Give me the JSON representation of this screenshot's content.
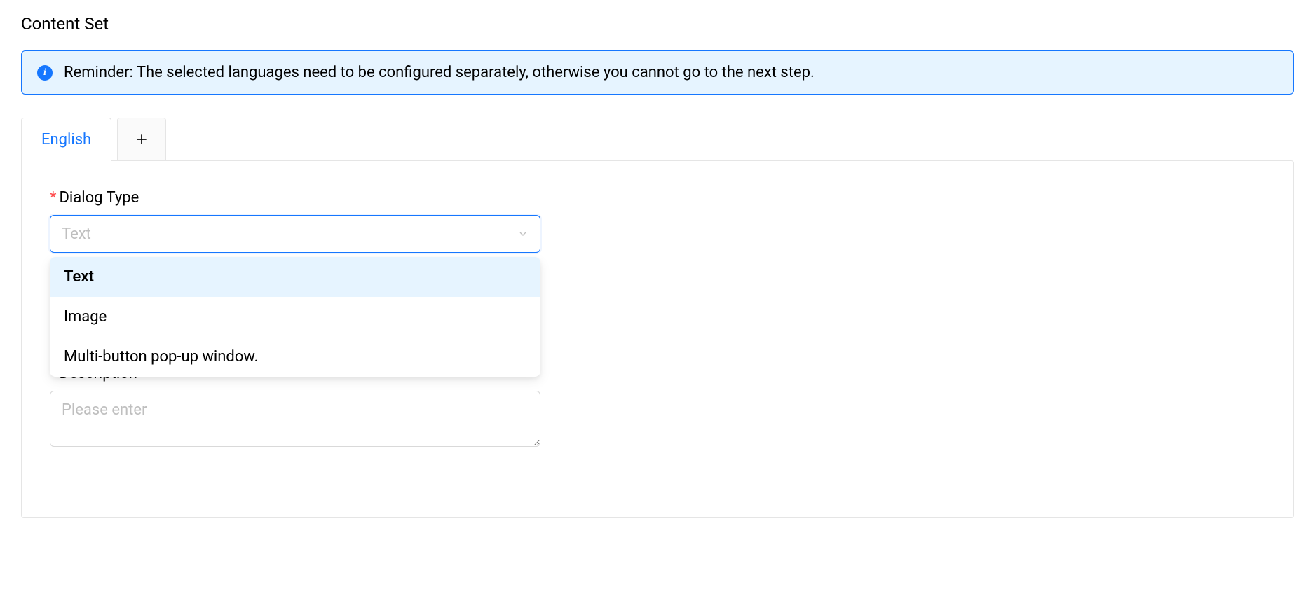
{
  "page": {
    "title": "Content Set"
  },
  "alert": {
    "text": "Reminder: The selected languages need to be configured separately, otherwise you cannot go to the next step."
  },
  "tabs": {
    "active": "English"
  },
  "form": {
    "dialog_type": {
      "label": "Dialog Type",
      "placeholder": "Text",
      "options": {
        "0": "Text",
        "1": "Image",
        "2": "Multi-button pop-up window."
      }
    },
    "description": {
      "label": "Description",
      "placeholder": "Please enter"
    }
  }
}
